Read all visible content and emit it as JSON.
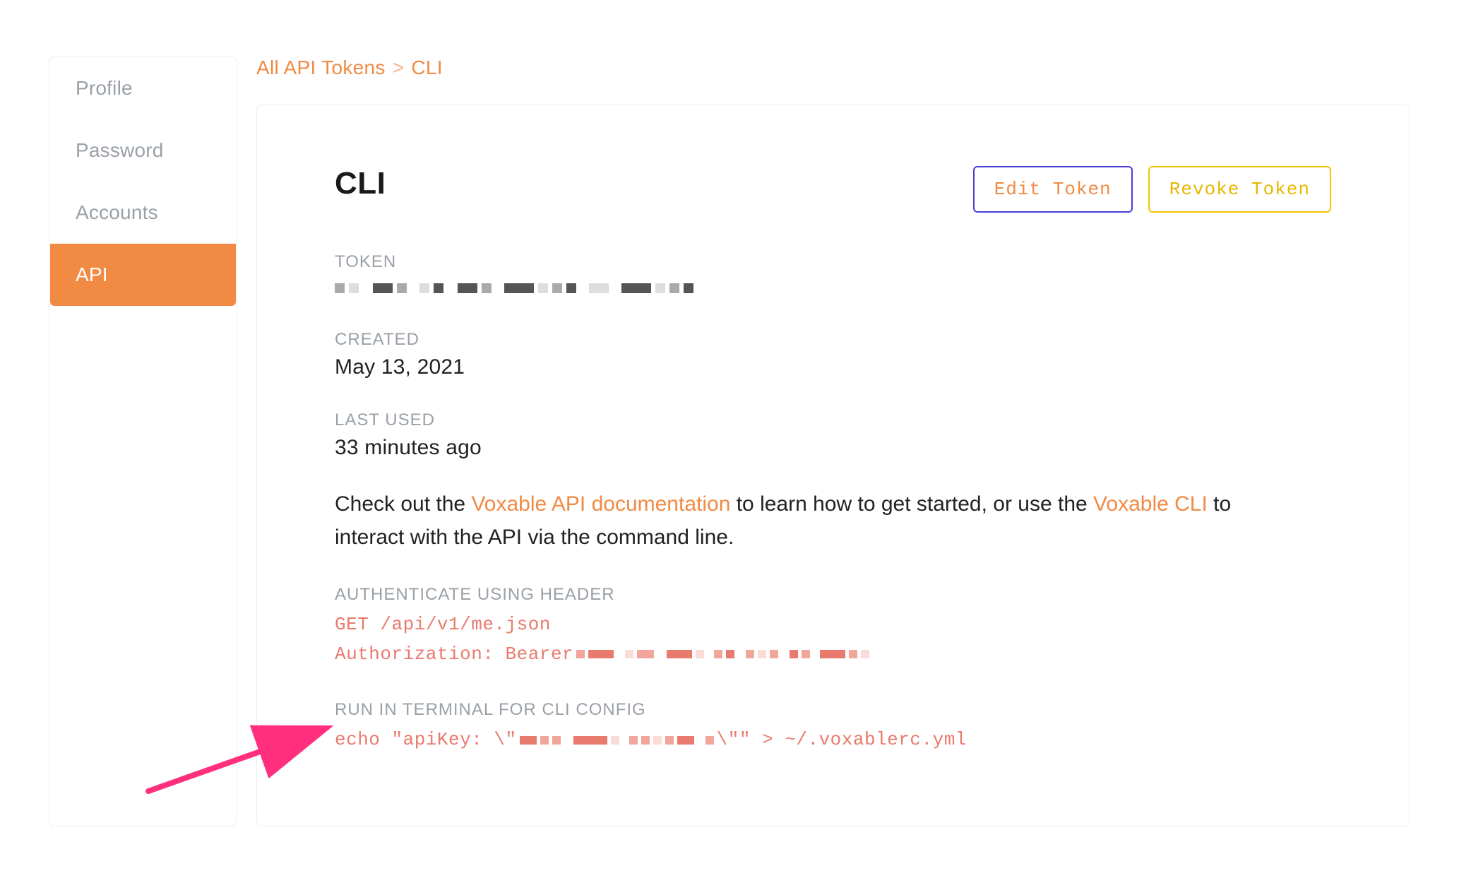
{
  "sidebar": {
    "items": [
      {
        "label": "Profile",
        "active": false
      },
      {
        "label": "Password",
        "active": false
      },
      {
        "label": "Accounts",
        "active": false
      },
      {
        "label": "API",
        "active": true
      }
    ]
  },
  "breadcrumb": {
    "parent": "All API Tokens",
    "separator": ">",
    "current": "CLI"
  },
  "header": {
    "title": "CLI",
    "edit_label": "Edit Token",
    "revoke_label": "Revoke Token"
  },
  "sections": {
    "token_label": "TOKEN",
    "created_label": "CREATED",
    "created_value": "May 13, 2021",
    "last_used_label": "LAST USED",
    "last_used_value": "33 minutes ago",
    "auth_header_label": "AUTHENTICATE USING HEADER",
    "auth_line1": "GET /api/v1/me.json",
    "auth_line2_prefix": "Authorization: Bearer ",
    "cli_config_label": "RUN IN TERMINAL FOR CLI CONFIG",
    "cli_prefix": "echo \"apiKey: \\\"",
    "cli_suffix": "\\\"\" > ~/.voxablerc.yml"
  },
  "description": {
    "t1": "Check out the ",
    "link1": "Voxable API documentation",
    "t2": " to learn how to get started, or use the ",
    "link2": "Voxable CLI",
    "t3": " to interact with the API via the command line."
  }
}
